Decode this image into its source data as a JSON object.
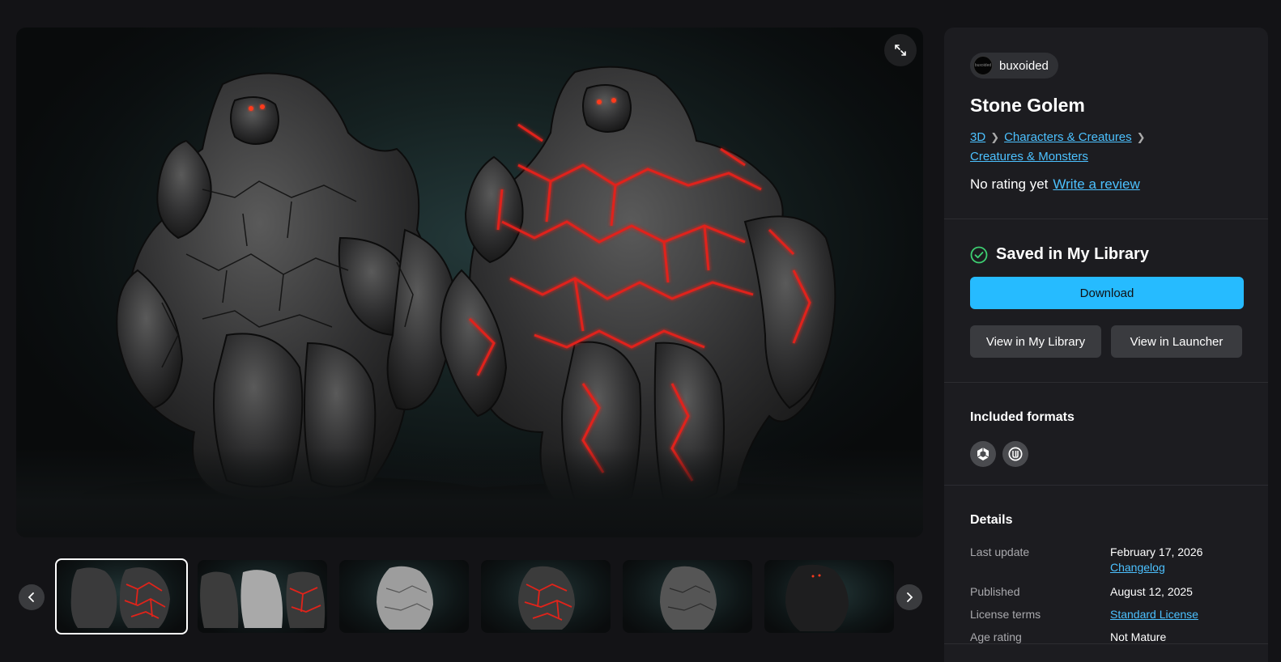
{
  "viewer": {
    "expand_icon": "expand-arrows-icon"
  },
  "gallery": {
    "prev_icon": "chevron-left-icon",
    "next_icon": "chevron-right-icon",
    "thumbnail_count": 6,
    "active_index": 0
  },
  "product": {
    "seller": "buxoided",
    "seller_avatar_text": "buxoided",
    "title": "Stone Golem",
    "breadcrumb": [
      "3D",
      "Characters & Creatures",
      "Creatures & Monsters"
    ],
    "rating_text": "No rating yet",
    "review_link": "Write a review"
  },
  "library": {
    "status": "Saved in My Library",
    "download_label": "Download",
    "view_library_label": "View in My Library",
    "view_launcher_label": "View in Launcher"
  },
  "formats": {
    "heading": "Included formats",
    "icons": [
      "unity-icon",
      "unreal-engine-icon"
    ]
  },
  "details": {
    "heading": "Details",
    "last_update_label": "Last update",
    "last_update_value": "February 17, 2026",
    "changelog_link": "Changelog",
    "published_label": "Published",
    "published_value": "August 12, 2025",
    "license_label": "License terms",
    "license_value": "Standard License",
    "age_label": "Age rating",
    "age_value": "Not Mature"
  },
  "colors": {
    "accent": "#26bbff",
    "link": "#4cc1ff",
    "success": "#3ecf72",
    "lava": "#e0231a"
  }
}
